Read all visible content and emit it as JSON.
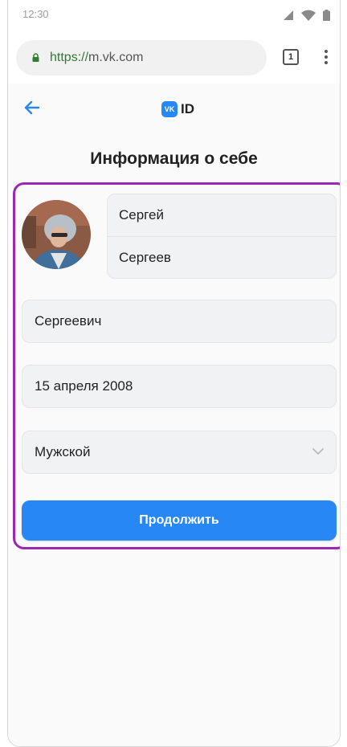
{
  "status_bar": {
    "time": "12:30"
  },
  "browser": {
    "url_scheme": "https://",
    "url_host": "m.vk.com",
    "tabs_count": "1"
  },
  "header": {
    "logo_badge": "VK",
    "logo_text": "ID"
  },
  "page": {
    "title": "Информация о себе"
  },
  "form": {
    "first_name": "Сергей",
    "last_name": "Сергеев",
    "patronymic": "Сергеевич",
    "birth_date": "15 апреля 2008",
    "gender": "Мужской",
    "continue_label": "Продолжить"
  },
  "colors": {
    "accent": "#2787f5",
    "highlight": "#9c27b0"
  }
}
